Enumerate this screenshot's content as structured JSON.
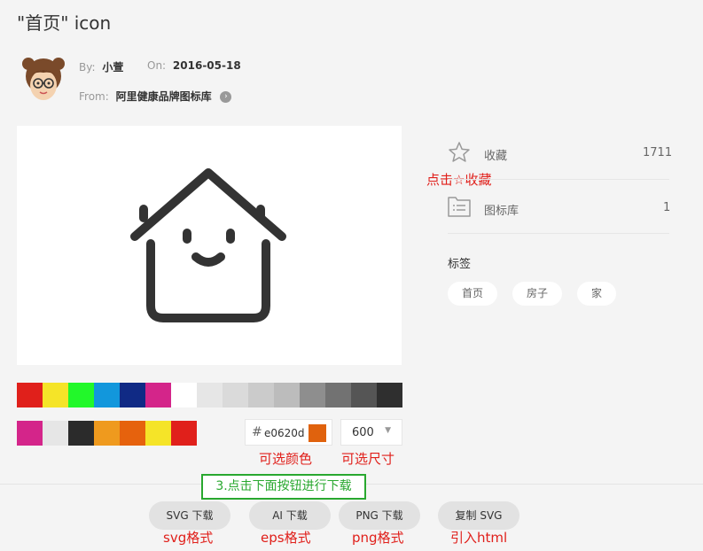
{
  "page": {
    "title": "\"首页\" icon"
  },
  "meta": {
    "by_label": "By:",
    "author": "小萱",
    "on_label": "On:",
    "date": "2016-05-18",
    "from_label": "From:",
    "library": "阿里健康品牌图标库"
  },
  "icon_preview": {
    "icon": "house-smile-icon",
    "color": "#333333"
  },
  "palette": {
    "row1": [
      "#e0201b",
      "#f5e428",
      "#22f82a",
      "#1297dc",
      "#102a85",
      "#d4258a",
      "#ffffff",
      "#e6e6e6",
      "#dadada",
      "#cbcbcb",
      "#bcbcbc",
      "#8e8e8e",
      "#727272",
      "#555555",
      "#2f2f2f"
    ],
    "row2": [
      "#d4258a",
      "#e6e6e6",
      "#2b2b2b",
      "#ef9a1e",
      "#e6620d",
      "#f5e428",
      "#e0201b"
    ]
  },
  "color_input": {
    "hash": "#",
    "value": "e0620d",
    "color": "#e0620d"
  },
  "size_select": {
    "value": "600"
  },
  "sidebar": {
    "favorite_label": "收藏",
    "favorite_count": "1711",
    "library_label": "图标库",
    "library_count": "1",
    "tags_heading": "标签",
    "tags": [
      "首页",
      "房子",
      "家"
    ]
  },
  "annotations": {
    "click_favorite": "点击☆收藏",
    "color_optional": "可选颜色",
    "size_optional": "可选尺寸",
    "click_download": "3.点击下面按钮进行下载",
    "svg_format": "svg格式",
    "eps_format": "eps格式",
    "png_format": "png格式",
    "import_html": "引入html"
  },
  "downloads": {
    "svg": "SVG 下载",
    "ai": "AI 下载",
    "png": "PNG 下载",
    "copy_svg": "复制 SVG"
  }
}
